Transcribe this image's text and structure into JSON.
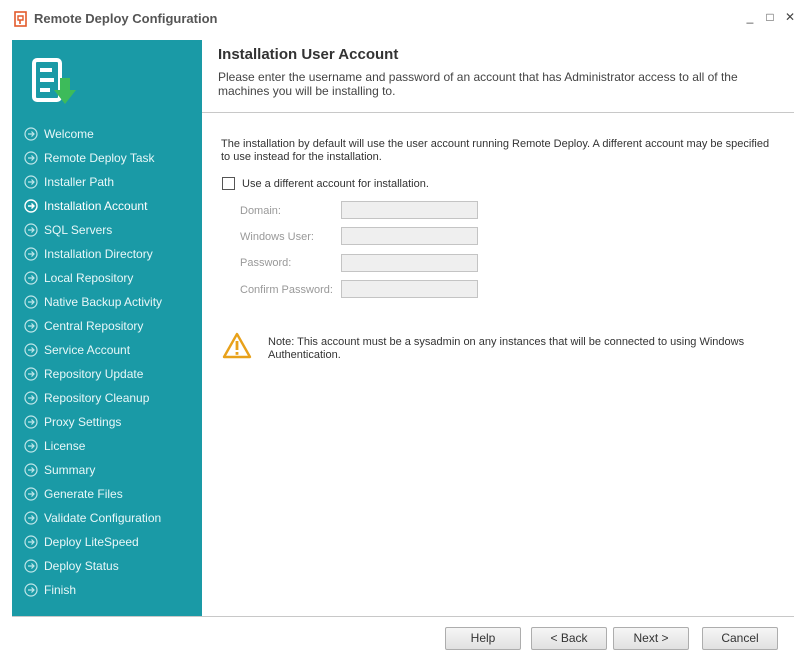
{
  "window": {
    "title": "Remote Deploy Configuration",
    "controls": {
      "minimize": "_",
      "maximize": "□",
      "close": "✕"
    }
  },
  "sidebar": {
    "items": [
      {
        "label": "Welcome",
        "active": false
      },
      {
        "label": "Remote Deploy Task",
        "active": false
      },
      {
        "label": "Installer Path",
        "active": false
      },
      {
        "label": "Installation Account",
        "active": true
      },
      {
        "label": "SQL Servers",
        "active": false
      },
      {
        "label": "Installation Directory",
        "active": false
      },
      {
        "label": "Local Repository",
        "active": false
      },
      {
        "label": "Native Backup Activity",
        "active": false
      },
      {
        "label": "Central Repository",
        "active": false
      },
      {
        "label": "Service Account",
        "active": false
      },
      {
        "label": "Repository Update",
        "active": false
      },
      {
        "label": "Repository Cleanup",
        "active": false
      },
      {
        "label": "Proxy Settings",
        "active": false
      },
      {
        "label": "License",
        "active": false
      },
      {
        "label": "Summary",
        "active": false
      },
      {
        "label": "Generate Files",
        "active": false
      },
      {
        "label": "Validate Configuration",
        "active": false
      },
      {
        "label": "Deploy LiteSpeed",
        "active": false
      },
      {
        "label": "Deploy Status",
        "active": false
      },
      {
        "label": "Finish",
        "active": false
      }
    ]
  },
  "header": {
    "title": "Installation User Account",
    "description": "Please enter the username and password of an account that has Administrator access to all of the machines you will be installing to."
  },
  "content": {
    "intro": "The installation by default will use the user account running Remote Deploy. A different account may be specified to use instead for the installation.",
    "checkbox_label": "Use a different account for installation.",
    "checkbox_checked": false,
    "fields": {
      "domain": {
        "label": "Domain:",
        "value": ""
      },
      "windows_user": {
        "label": "Windows User:",
        "value": ""
      },
      "password": {
        "label": "Password:",
        "value": ""
      },
      "confirm_password": {
        "label": "Confirm Password:",
        "value": ""
      }
    },
    "note": "Note: This account must be a sysadmin on any instances that will be connected to using Windows Authentication."
  },
  "footer": {
    "help": "Help",
    "back": "< Back",
    "next": "Next >",
    "cancel": "Cancel"
  },
  "colors": {
    "sidebar_bg": "#1a9aa6",
    "accent_green": "#3dbb5a",
    "warning": "#e8a11a",
    "app_icon": "#e35a2b"
  }
}
